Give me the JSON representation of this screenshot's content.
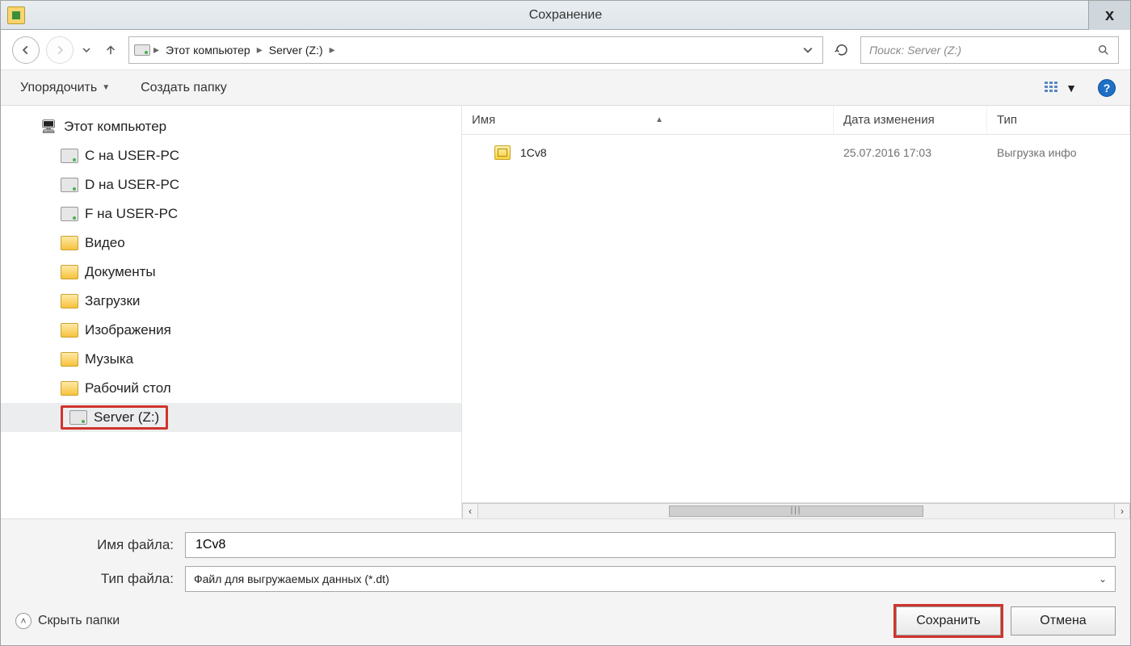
{
  "title": "Сохранение",
  "breadcrumb": {
    "root": "Этот компьютер",
    "location": "Server (Z:)"
  },
  "search": {
    "placeholder": "Поиск: Server (Z:)"
  },
  "toolbar": {
    "organize": "Упорядочить",
    "new_folder": "Создать папку"
  },
  "tree": {
    "root": "Этот компьютер",
    "items": [
      {
        "label": "C на USER-PC",
        "icon": "netdrive"
      },
      {
        "label": "D на USER-PC",
        "icon": "netdrive"
      },
      {
        "label": "F на USER-PC",
        "icon": "netdrive"
      },
      {
        "label": "Видео",
        "icon": "folder"
      },
      {
        "label": "Документы",
        "icon": "folder"
      },
      {
        "label": "Загрузки",
        "icon": "folder"
      },
      {
        "label": "Изображения",
        "icon": "folder"
      },
      {
        "label": "Музыка",
        "icon": "folder"
      },
      {
        "label": "Рабочий стол",
        "icon": "folder"
      },
      {
        "label": "Server (Z:)",
        "icon": "netdrive",
        "selected": true,
        "highlighted": true
      }
    ]
  },
  "columns": {
    "name": "Имя",
    "date": "Дата изменения",
    "type": "Тип"
  },
  "files": [
    {
      "name": "1Cv8",
      "date": "25.07.2016 17:03",
      "type": "Выгрузка инфо"
    }
  ],
  "form": {
    "filename_label": "Имя файла:",
    "filename_value": "1Cv8",
    "filetype_label": "Тип файла:",
    "filetype_value": "Файл для выгружаемых данных (*.dt)"
  },
  "actions": {
    "hide_folders": "Скрыть папки",
    "save": "Сохранить",
    "cancel": "Отмена"
  }
}
